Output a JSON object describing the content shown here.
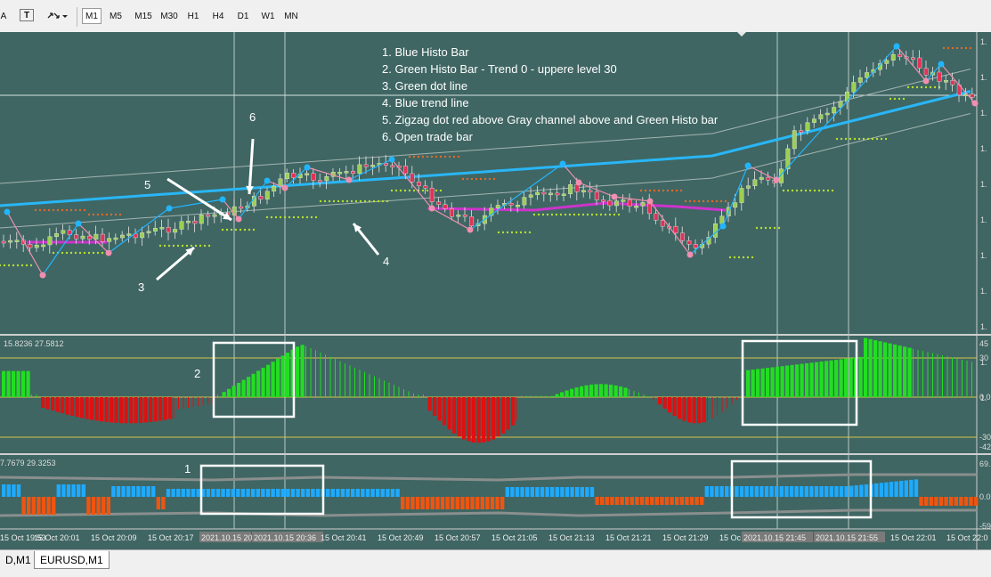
{
  "toolbar": {
    "left_label": "A",
    "text_tool_label": "T",
    "timeframes": [
      "M1",
      "M5",
      "M15",
      "M30",
      "H1",
      "H4",
      "D1",
      "W1",
      "MN"
    ],
    "selected_timeframe": "M1"
  },
  "annotations": {
    "legend": [
      "1. Blue Histo Bar",
      "2. Green Histo Bar - Trend 0 - uppere level 30",
      "3. Green dot line",
      "4. Blue trend line",
      "5. Zigzag dot red above Gray channel  above and Green Histo bar",
      "6. Open trade bar"
    ],
    "labels": [
      "6",
      "5",
      "3",
      "4",
      "2",
      "1"
    ]
  },
  "indicator1": {
    "header": "15.8236 27.5812",
    "scale": [
      "45",
      "30",
      "0.0",
      "-30",
      "-42"
    ],
    "levels": [
      30,
      0,
      -30
    ]
  },
  "indicator2": {
    "header": "7.7679 29.3253",
    "scale": [
      "69.",
      "0.0",
      "-59"
    ]
  },
  "price_scale": [
    "1.",
    "1.",
    "1.",
    "1.",
    "1.",
    "1.",
    "1.",
    "1.",
    "1.",
    "1.",
    "1."
  ],
  "time_axis": [
    "15 Oct 19:53",
    "15 Oct 20:01",
    "15 Oct 20:09",
    "15 Oct 20:17",
    "2021.10.15 20:",
    "2021.10.15 20:36",
    "15 Oct 20:41",
    "15 Oct 20:49",
    "15 Oct 20:57",
    "15 Oct 21:05",
    "15 Oct 21:13",
    "15 Oct 21:21",
    "15 Oct 21:29",
    "15 Oc",
    "2021.10.15 21:45",
    "2021.10.15 21:55",
    "15 Oct 22:01",
    "15 Oct 22:0"
  ],
  "tabs": [
    "D,M1",
    "EURUSD,M1"
  ],
  "active_tab": "EURUSD,M1",
  "colors": {
    "background": "#3f6663",
    "bull": "#9ccf52",
    "bear": "#e0335a",
    "trend_line": "#29b6f6",
    "ma_purple": "#cc33cc",
    "green_dot": "#b7e02f",
    "red_dot": "#e06a2a",
    "zigzag_up": "#22b5ff",
    "zigzag_down": "#ef8fb0",
    "histo_green": "#22dd22",
    "histo_red": "#dd1111",
    "histo_blue": "#1eaaff",
    "histo_orange": "#ee5511",
    "level_line": "#d6c64a",
    "annotation": "#ffffff"
  }
}
